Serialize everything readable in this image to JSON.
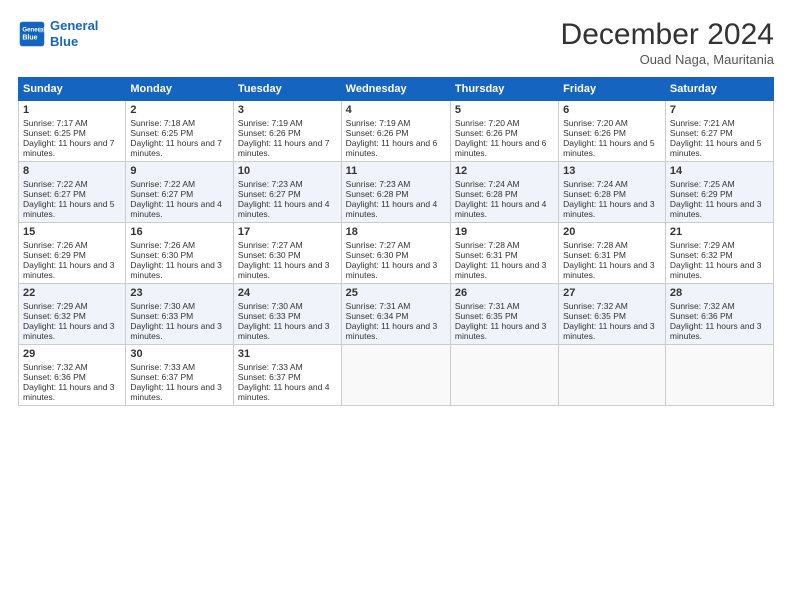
{
  "logo": {
    "line1": "General",
    "line2": "Blue"
  },
  "title": "December 2024",
  "location": "Ouad Naga, Mauritania",
  "days_of_week": [
    "Sunday",
    "Monday",
    "Tuesday",
    "Wednesday",
    "Thursday",
    "Friday",
    "Saturday"
  ],
  "weeks": [
    [
      {
        "day": 1,
        "sunrise": "7:17 AM",
        "sunset": "6:25 PM",
        "daylight": "11 hours and 7 minutes."
      },
      {
        "day": 2,
        "sunrise": "7:18 AM",
        "sunset": "6:25 PM",
        "daylight": "11 hours and 7 minutes."
      },
      {
        "day": 3,
        "sunrise": "7:19 AM",
        "sunset": "6:26 PM",
        "daylight": "11 hours and 7 minutes."
      },
      {
        "day": 4,
        "sunrise": "7:19 AM",
        "sunset": "6:26 PM",
        "daylight": "11 hours and 6 minutes."
      },
      {
        "day": 5,
        "sunrise": "7:20 AM",
        "sunset": "6:26 PM",
        "daylight": "11 hours and 6 minutes."
      },
      {
        "day": 6,
        "sunrise": "7:20 AM",
        "sunset": "6:26 PM",
        "daylight": "11 hours and 5 minutes."
      },
      {
        "day": 7,
        "sunrise": "7:21 AM",
        "sunset": "6:27 PM",
        "daylight": "11 hours and 5 minutes."
      }
    ],
    [
      {
        "day": 8,
        "sunrise": "7:22 AM",
        "sunset": "6:27 PM",
        "daylight": "11 hours and 5 minutes."
      },
      {
        "day": 9,
        "sunrise": "7:22 AM",
        "sunset": "6:27 PM",
        "daylight": "11 hours and 4 minutes."
      },
      {
        "day": 10,
        "sunrise": "7:23 AM",
        "sunset": "6:27 PM",
        "daylight": "11 hours and 4 minutes."
      },
      {
        "day": 11,
        "sunrise": "7:23 AM",
        "sunset": "6:28 PM",
        "daylight": "11 hours and 4 minutes."
      },
      {
        "day": 12,
        "sunrise": "7:24 AM",
        "sunset": "6:28 PM",
        "daylight": "11 hours and 4 minutes."
      },
      {
        "day": 13,
        "sunrise": "7:24 AM",
        "sunset": "6:28 PM",
        "daylight": "11 hours and 3 minutes."
      },
      {
        "day": 14,
        "sunrise": "7:25 AM",
        "sunset": "6:29 PM",
        "daylight": "11 hours and 3 minutes."
      }
    ],
    [
      {
        "day": 15,
        "sunrise": "7:26 AM",
        "sunset": "6:29 PM",
        "daylight": "11 hours and 3 minutes."
      },
      {
        "day": 16,
        "sunrise": "7:26 AM",
        "sunset": "6:30 PM",
        "daylight": "11 hours and 3 minutes."
      },
      {
        "day": 17,
        "sunrise": "7:27 AM",
        "sunset": "6:30 PM",
        "daylight": "11 hours and 3 minutes."
      },
      {
        "day": 18,
        "sunrise": "7:27 AM",
        "sunset": "6:30 PM",
        "daylight": "11 hours and 3 minutes."
      },
      {
        "day": 19,
        "sunrise": "7:28 AM",
        "sunset": "6:31 PM",
        "daylight": "11 hours and 3 minutes."
      },
      {
        "day": 20,
        "sunrise": "7:28 AM",
        "sunset": "6:31 PM",
        "daylight": "11 hours and 3 minutes."
      },
      {
        "day": 21,
        "sunrise": "7:29 AM",
        "sunset": "6:32 PM",
        "daylight": "11 hours and 3 minutes."
      }
    ],
    [
      {
        "day": 22,
        "sunrise": "7:29 AM",
        "sunset": "6:32 PM",
        "daylight": "11 hours and 3 minutes."
      },
      {
        "day": 23,
        "sunrise": "7:30 AM",
        "sunset": "6:33 PM",
        "daylight": "11 hours and 3 minutes."
      },
      {
        "day": 24,
        "sunrise": "7:30 AM",
        "sunset": "6:33 PM",
        "daylight": "11 hours and 3 minutes."
      },
      {
        "day": 25,
        "sunrise": "7:31 AM",
        "sunset": "6:34 PM",
        "daylight": "11 hours and 3 minutes."
      },
      {
        "day": 26,
        "sunrise": "7:31 AM",
        "sunset": "6:35 PM",
        "daylight": "11 hours and 3 minutes."
      },
      {
        "day": 27,
        "sunrise": "7:32 AM",
        "sunset": "6:35 PM",
        "daylight": "11 hours and 3 minutes."
      },
      {
        "day": 28,
        "sunrise": "7:32 AM",
        "sunset": "6:36 PM",
        "daylight": "11 hours and 3 minutes."
      }
    ],
    [
      {
        "day": 29,
        "sunrise": "7:32 AM",
        "sunset": "6:36 PM",
        "daylight": "11 hours and 3 minutes."
      },
      {
        "day": 30,
        "sunrise": "7:33 AM",
        "sunset": "6:37 PM",
        "daylight": "11 hours and 3 minutes."
      },
      {
        "day": 31,
        "sunrise": "7:33 AM",
        "sunset": "6:37 PM",
        "daylight": "11 hours and 4 minutes."
      },
      null,
      null,
      null,
      null
    ]
  ]
}
